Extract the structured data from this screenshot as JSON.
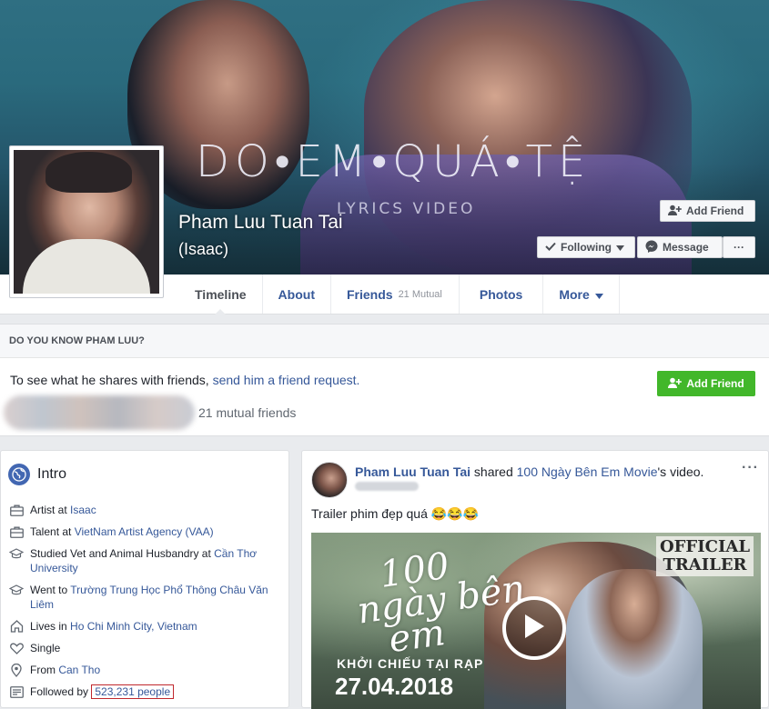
{
  "cover": {
    "title": "DO•EM•QUÁ•TỆ",
    "subtitle": "LYRICS VIDEO"
  },
  "profile": {
    "name": "Pham Luu Tuan Tai",
    "alternate_name": "(Isaac)"
  },
  "cover_buttons": {
    "add_friend": "Add Friend",
    "following": "Following",
    "message": "Message",
    "more": "···"
  },
  "tabs": [
    {
      "label": "Timeline",
      "count": ""
    },
    {
      "label": "About",
      "count": ""
    },
    {
      "label": "Friends",
      "count": "21 Mutual"
    },
    {
      "label": "Photos",
      "count": ""
    },
    {
      "label": "More",
      "count": ""
    }
  ],
  "know": {
    "header": "DO YOU KNOW PHAM LUU?",
    "text_prefix": "To see what he shares with friends, ",
    "text_link": "send him a friend request.",
    "button": "Add Friend",
    "mutual": "21 mutual friends"
  },
  "intro": {
    "title": "Intro",
    "rows": [
      {
        "icon": "briefcase-icon",
        "prefix": "Artist at ",
        "link": "Isaac",
        "suffix": ""
      },
      {
        "icon": "briefcase-icon",
        "prefix": "Talent at ",
        "link": "VietNam Artist Agency (VAA)",
        "suffix": ""
      },
      {
        "icon": "graduation-cap-icon",
        "prefix": "Studied Vet and Animal Husbandry at ",
        "link": "Cần Thơ University",
        "suffix": ""
      },
      {
        "icon": "graduation-cap-icon",
        "prefix": "Went to ",
        "link": "Trường Trung Học Phổ Thông Châu Văn Liêm",
        "suffix": ""
      },
      {
        "icon": "home-icon",
        "prefix": "Lives in ",
        "link": "Ho Chi Minh City, Vietnam",
        "suffix": ""
      },
      {
        "icon": "heart-icon",
        "prefix": "Single",
        "link": "",
        "suffix": ""
      },
      {
        "icon": "location-pin-icon",
        "prefix": "From ",
        "link": "Can Tho",
        "suffix": ""
      },
      {
        "icon": "rss-icon",
        "prefix": "Followed by ",
        "link": "523,231 people",
        "suffix": ""
      }
    ]
  },
  "post": {
    "author": "Pham Luu Tuan Tai",
    "action": " shared ",
    "page": "100 Ngày Bên Em Movie",
    "suffix": "'s video.",
    "options": "···",
    "text": "Trailer phim đẹp quá 😂😂😂",
    "video": {
      "badge_line1": "OFFICIAL",
      "badge_line2": "TRAILER",
      "title_line1": "100",
      "title_line2": "ngày bên",
      "title_line3": "em",
      "release_label": "KHỞI CHIẾU TẠI RẠP",
      "release_date": "27.04.2018"
    }
  }
}
